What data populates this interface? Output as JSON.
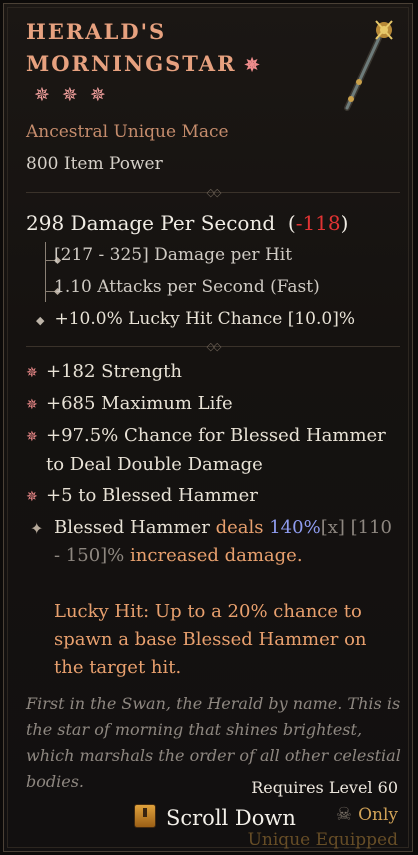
{
  "item": {
    "name_line1": "Herald's",
    "name_line2": "Morningstar",
    "type": "Ancestral Unique Mace",
    "item_power": "800 Item Power",
    "dps_value": "298 Damage Per Second",
    "dps_diff": "-118",
    "damage_per_hit": "[217 - 325] Damage per Hit",
    "attacks_per_second": "1.10 Attacks per Second (Fast)",
    "lucky_hit_chance": "+10.0% Lucky Hit Chance [10.0]%"
  },
  "stats": [
    "+182 Strength",
    "+685 Maximum Life",
    "+97.5% Chance for Blessed Hammer",
    "to Deal Double Damage",
    "+5 to Blessed Hammer"
  ],
  "aspect": {
    "part1": "Blessed Hammer",
    "part2": "deals",
    "value": "140%",
    "marker": "[x]",
    "range": "[110 - 150]%",
    "part3": "increased damage."
  },
  "lucky_hit": "Lucky Hit: Up to a 20% chance to spawn a base Blessed Hammer on the target hit.",
  "flavor": "First in the Swan, the Herald by name. This is the star of morning that shines brightest, which marshals the order of all other celestial bodies.",
  "requires": "Requires Level 60",
  "scroll_label": "Scroll Down",
  "class_only": "Only",
  "equipped_note": "Unique Equipped",
  "colors": {
    "title": "#e7a17f",
    "unique_orange": "#e8a06e",
    "negative": "#e03333",
    "highlight_blue": "#8f9cf0"
  },
  "icons": [
    "ornament-icon",
    "rank-star-icon",
    "weapon-mace-icon",
    "stat-bullet-icon",
    "aspect-icon",
    "key-icon",
    "skull-icon"
  ]
}
